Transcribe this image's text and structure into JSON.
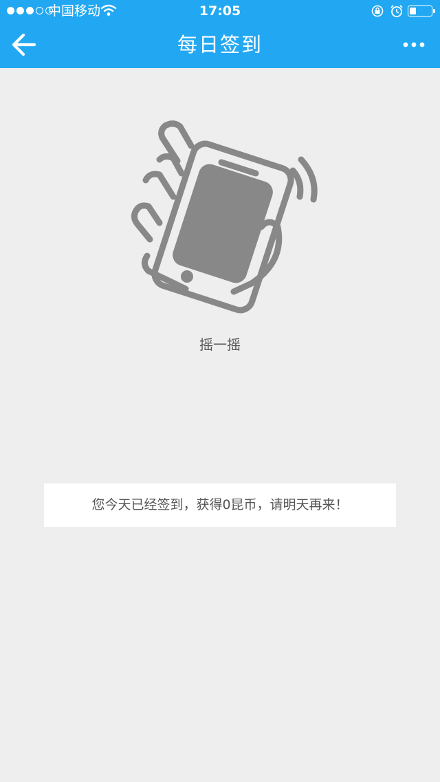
{
  "status_bar": {
    "carrier": "中国移动",
    "time": "17:05",
    "signal_icon": "signal-dots-icon",
    "wifi_icon": "wifi-icon",
    "rotation_lock_icon": "rotation-lock-icon",
    "alarm_icon": "alarm-icon",
    "battery_icon": "battery-icon",
    "battery_level": 0.3
  },
  "navbar": {
    "title": "每日签到",
    "back_icon": "arrow-left-icon",
    "more_icon": "more-dots-icon",
    "background": "#22a8f2"
  },
  "main": {
    "illustration": "shake-phone-icon",
    "shake_label": "摇一摇",
    "notice": "您今天已经签到，获得0昆币，请明天再来！"
  },
  "colors": {
    "accent": "#22a8f2",
    "page_bg": "#eeeeee",
    "icon_gray": "#888888",
    "text_gray": "#555555"
  }
}
